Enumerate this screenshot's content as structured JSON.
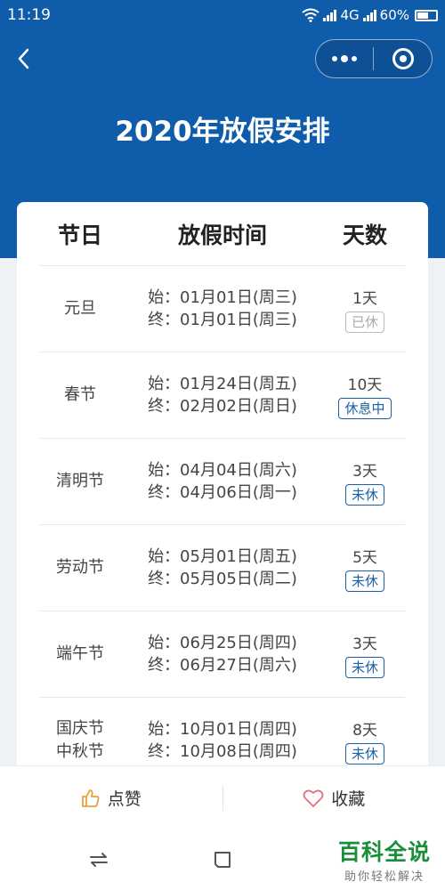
{
  "status_bar": {
    "time": "11:19",
    "network": "4G",
    "battery": "60%"
  },
  "page": {
    "title": "2020年放假安排"
  },
  "table": {
    "headers": [
      "节日",
      "放假时间",
      "天数"
    ],
    "rows": [
      {
        "name": "元旦",
        "start": "始：01月01日(周三)",
        "end": "终：01月01日(周三)",
        "days": "1天",
        "status": "已休",
        "done": true
      },
      {
        "name": "春节",
        "start": "始：01月24日(周五)",
        "end": "终：02月02日(周日)",
        "days": "10天",
        "status": "休息中",
        "done": false
      },
      {
        "name": "清明节",
        "start": "始：04月04日(周六)",
        "end": "终：04月06日(周一)",
        "days": "3天",
        "status": "未休",
        "done": false
      },
      {
        "name": "劳动节",
        "start": "始：05月01日(周五)",
        "end": "终：05月05日(周二)",
        "days": "5天",
        "status": "未休",
        "done": false
      },
      {
        "name": "端午节",
        "start": "始：06月25日(周四)",
        "end": "终：06月27日(周六)",
        "days": "3天",
        "status": "未休",
        "done": false
      },
      {
        "name": "国庆节\n中秋节",
        "start": "始：10月01日(周四)",
        "end": "终：10月08日(周四)",
        "days": "8天",
        "status": "未休",
        "done": false
      }
    ]
  },
  "bottom_bar": {
    "like_label": "点赞",
    "favorite_label": "收藏"
  },
  "watermark": {
    "main": "百科全说",
    "sub": "助你轻松解决"
  },
  "colors": {
    "header_blue": "#0f5cab",
    "badge_blue": "#1a5fa8",
    "watermark_green": "#1a8f3a"
  }
}
